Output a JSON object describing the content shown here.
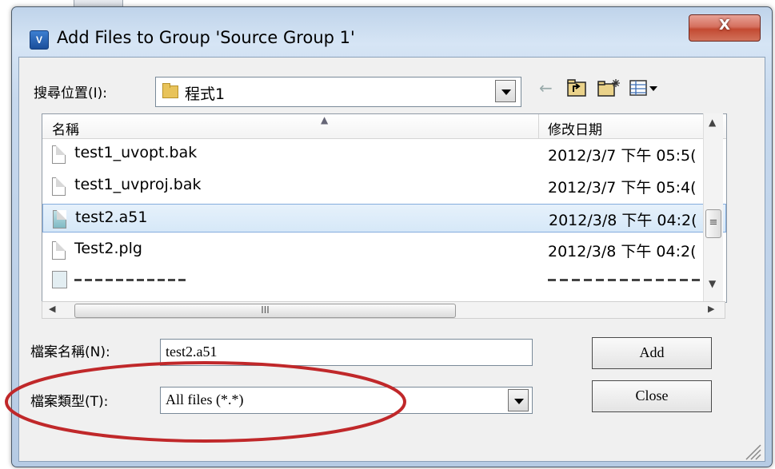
{
  "window": {
    "title": "Add Files to Group 'Source Group 1'",
    "close_label": "X",
    "app_icon_text": "V"
  },
  "look_in": {
    "label": "搜尋位置(I):",
    "value": "程式1"
  },
  "toolbar": {
    "back_icon": "back-arrow-icon",
    "up_icon": "up-folder-icon",
    "new_folder_icon": "new-folder-icon",
    "view_icon": "view-menu-icon"
  },
  "file_list": {
    "columns": [
      "名稱",
      "修改日期"
    ],
    "rows": [
      {
        "name": "test1_uvopt.bak",
        "date": "2012/3/7 下午 05:5("
      },
      {
        "name": "test1_uvproj.bak",
        "date": "2012/3/7 下午 05:4("
      },
      {
        "name": "test2.a51",
        "date": "2012/3/8 下午 04:2(",
        "selected": true
      },
      {
        "name": "Test2.plg",
        "date": "2012/3/8 下午 04:2("
      }
    ],
    "hscroll_grip": "III"
  },
  "file_name": {
    "label": "檔案名稱(N):",
    "value": "test2.a51"
  },
  "file_type": {
    "label": "檔案類型(T):",
    "value": "All files (*.*)"
  },
  "buttons": {
    "add": "Add",
    "close": "Close"
  },
  "annotation": {
    "color": "#c0282a"
  }
}
